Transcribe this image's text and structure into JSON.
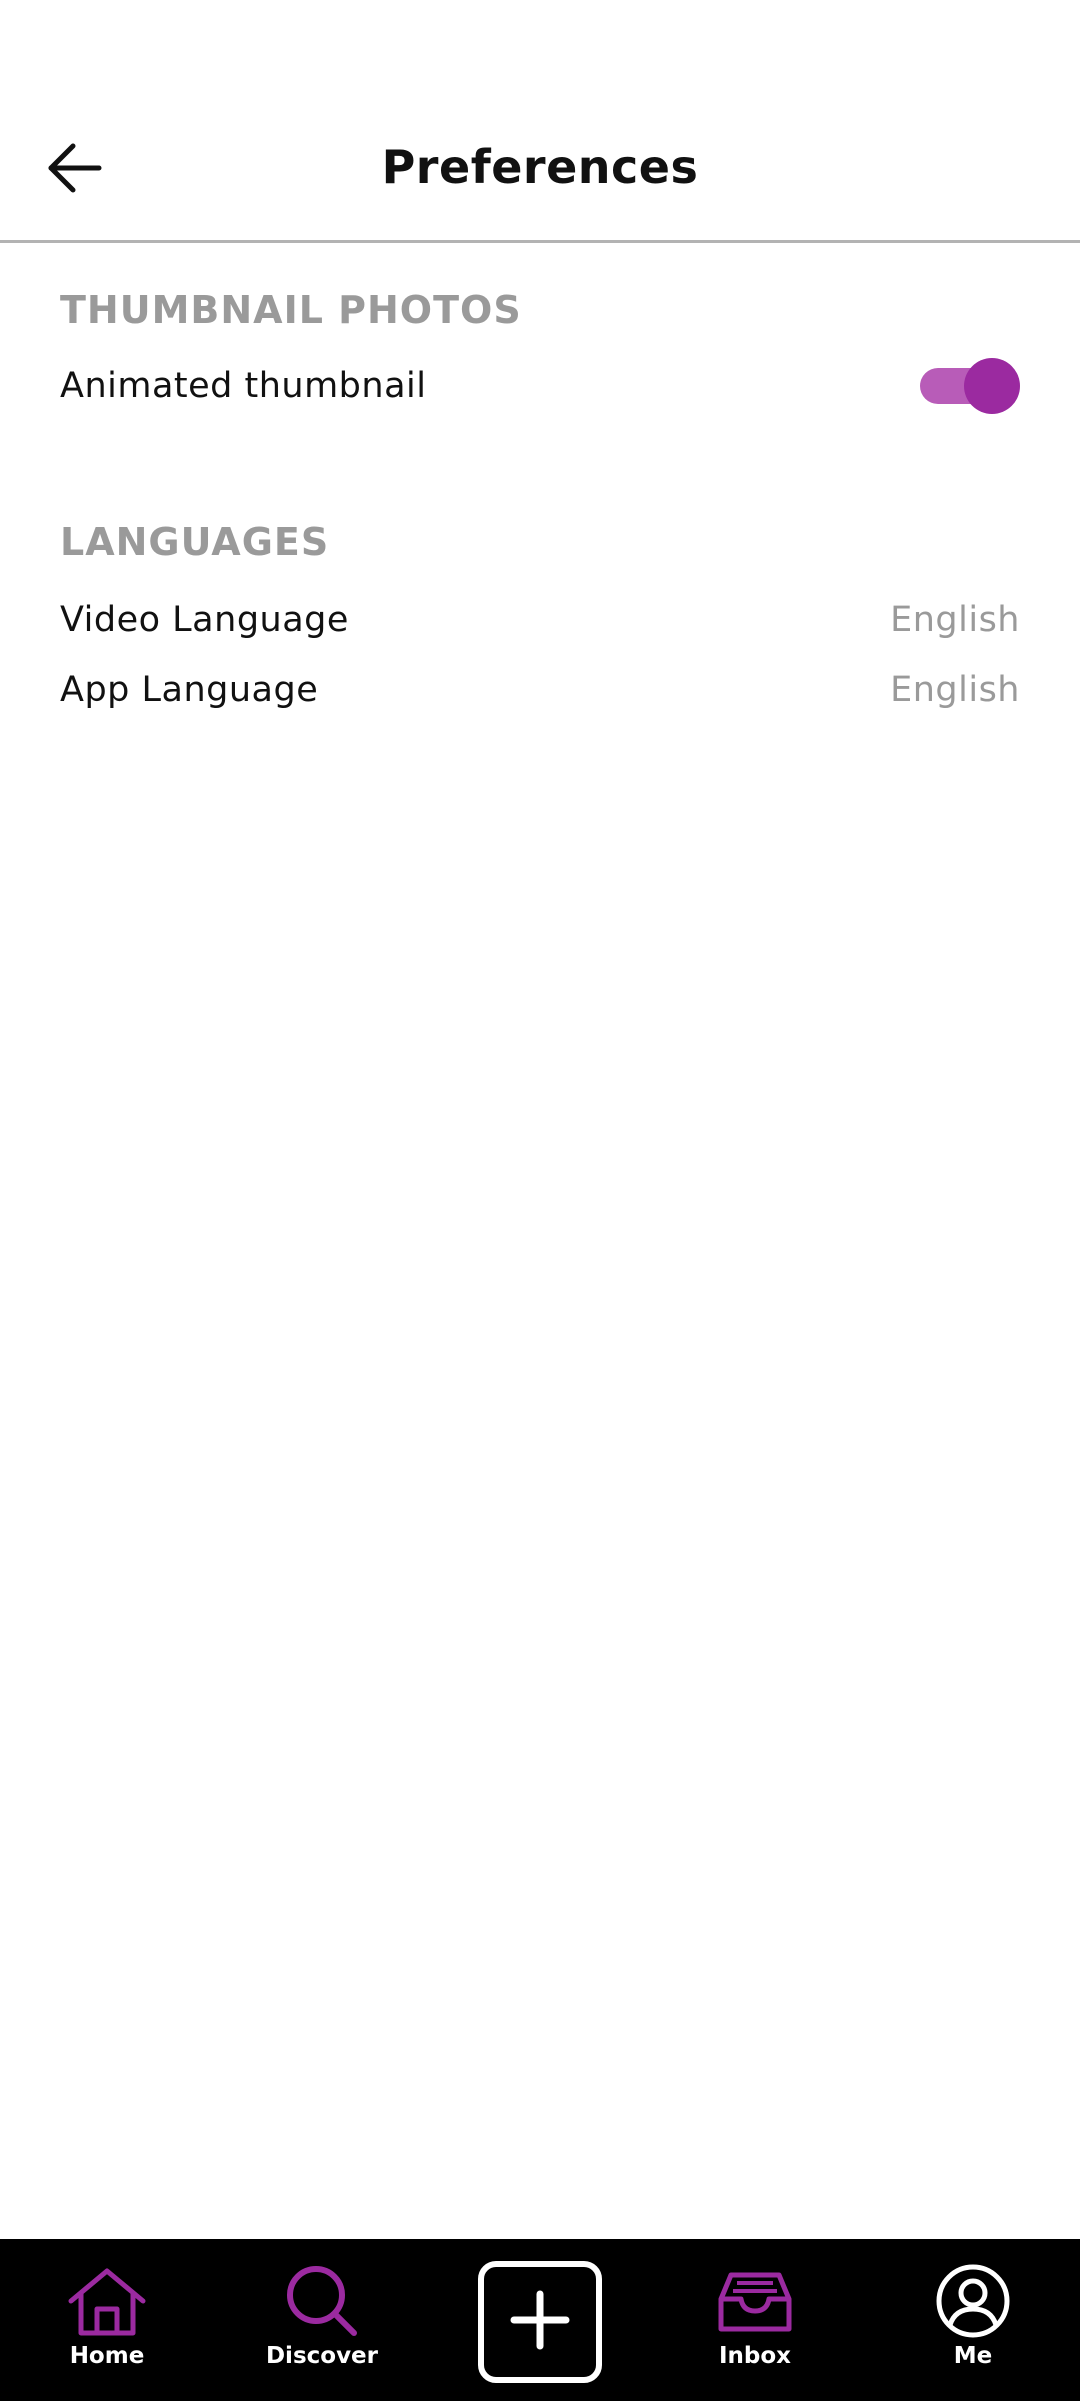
{
  "header": {
    "title": "Preferences",
    "back_icon": "arrow-left-icon"
  },
  "sections": {
    "thumbnail": {
      "title": "THUMBNAIL PHOTOS",
      "animated_label": "Animated thumbnail",
      "animated_enabled": true
    },
    "languages": {
      "title": "LANGUAGES",
      "video_label": "Video Language",
      "video_value": "English",
      "app_label": "App Language",
      "app_value": "English"
    }
  },
  "bottom_nav": {
    "home": {
      "label": "Home",
      "icon": "home-icon"
    },
    "discover": {
      "label": "Discover",
      "icon": "search-icon"
    },
    "create": {
      "icon": "plus-icon"
    },
    "inbox": {
      "label": "Inbox",
      "icon": "inbox-icon"
    },
    "me": {
      "label": "Me",
      "icon": "profile-icon"
    }
  },
  "colors": {
    "accent": "#9b2aa0",
    "toggle_track": "#b85cb8",
    "section_title": "#9a9a9a",
    "nav_background": "#000000"
  }
}
